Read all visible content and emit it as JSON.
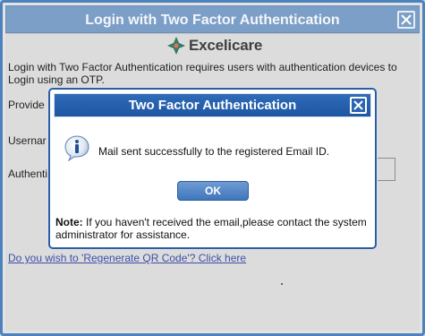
{
  "background_dialog": {
    "title": "Login with Two Factor Authentication",
    "close_icon": "close-x-icon",
    "logo": {
      "text": "Excelicare",
      "mark_icon": "excelicare-star-icon"
    },
    "intro_text": "Login with Two Factor Authentication requires users with authentication devices to Login using an OTP.",
    "row1_label": "Provide",
    "row2_label": "Usernar",
    "row3_label": "Authenti",
    "regenerate_link": "Do you wish to 'Regenerate QR Code'? Click here"
  },
  "modal": {
    "title": "Two Factor Authentication",
    "close_icon": "close-x-icon",
    "info_icon": "info-icon",
    "message": "Mail sent successfully to the registered Email ID.",
    "ok_label": "OK",
    "note_label": "Note:",
    "note_text": " If you haven't received the email,please contact the system administrator for assistance."
  },
  "colors": {
    "outer_titlebar": "#7c9fc8",
    "modal_titlebar": "#1e56a3",
    "ok_button": "#3f76bc",
    "link": "#3f4fa8"
  }
}
